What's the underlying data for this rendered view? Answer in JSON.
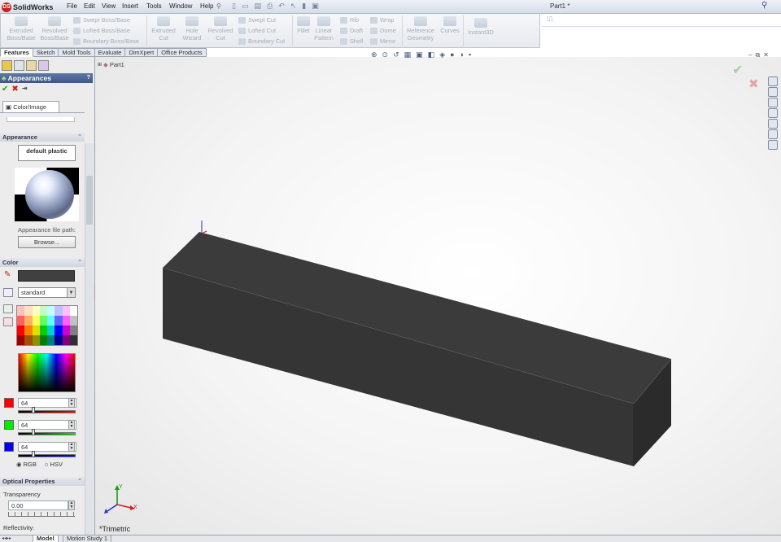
{
  "app": {
    "name": "SolidWorks",
    "document_title": "Part1 *"
  },
  "menu": [
    "File",
    "Edit",
    "View",
    "Insert",
    "Tools",
    "Window",
    "Help"
  ],
  "ribbon": {
    "extruded_boss": "Extruded Boss/Base",
    "revolved_boss": "Revolved Boss/Base",
    "swept_boss": "Swept Boss/Base",
    "lofted_boss": "Lofted Boss/Base",
    "boundary_boss": "Boundary Boss/Base",
    "extruded_cut": "Extruded Cut",
    "hole_wizard": "Hole Wizard",
    "revolved_cut": "Revolved Cut",
    "swept_cut": "Swept Cut",
    "lofted_cut": "Lofted Cut",
    "boundary_cut": "Boundary Cut",
    "fillet": "Fillet",
    "linear_pattern": "Linear Pattern",
    "rib": "Rib",
    "draft": "Draft",
    "shell": "Shell",
    "wrap": "Wrap",
    "dome": "Dome",
    "mirror": "Mirror",
    "reference_geometry": "Reference Geometry",
    "curves": "Curves",
    "instant3d": "Instant3D"
  },
  "tabs": [
    "Features",
    "Sketch",
    "Mold Tools",
    "Evaluate",
    "DimXpert",
    "Office Products"
  ],
  "property_manager": {
    "title": "Appearances",
    "subtab": "Color/Image",
    "appearance_section": "Appearance",
    "appearance_name": "default plastic",
    "file_path_label": "Appearance file path:",
    "browse_button": "Browse...",
    "color_section": "Color",
    "palette_select": "standard",
    "red_value": "64",
    "green_value": "64",
    "blue_value": "64",
    "rgb_label": "RGB",
    "hsv_label": "HSV",
    "optical_section": "Optical Properties",
    "transparency_label": "Transparency",
    "transparency_value": "0.00",
    "reflectivity_label": "Reflectivity:"
  },
  "tree": {
    "root": "Part1"
  },
  "view": {
    "orientation": "*Trimetric"
  },
  "bottom_tabs": [
    "Model",
    "Motion Study 1"
  ],
  "colors": {
    "part": "#353535",
    "red": "#ff0000",
    "green": "#00ee00",
    "blue": "#0000ff"
  }
}
